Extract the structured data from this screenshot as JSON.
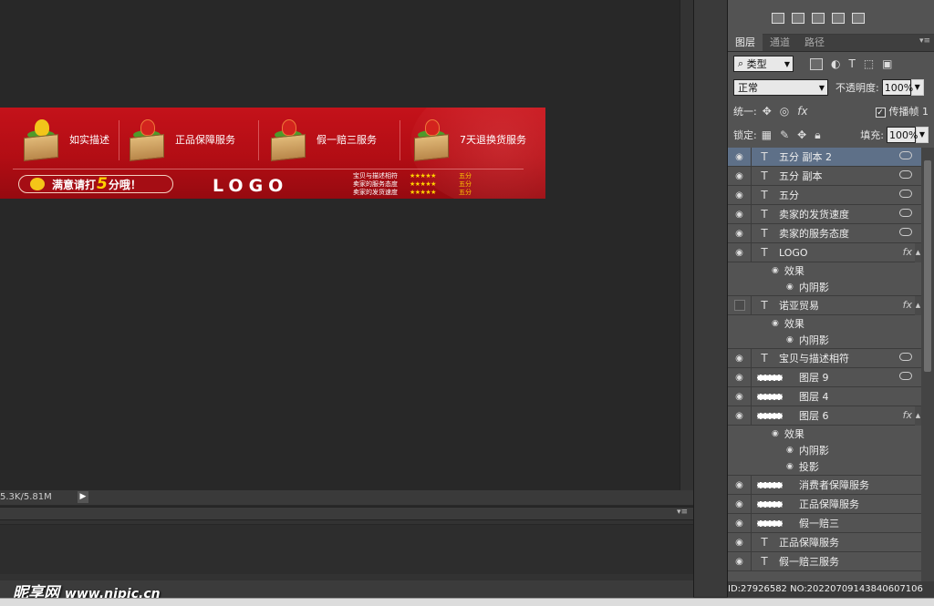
{
  "status": {
    "doc_size": "5.3K/5.81M"
  },
  "watermark": {
    "site": "昵享网",
    "url": "www.nipic.cn"
  },
  "id_line": "ID:27926582 NO:20220709143840607106",
  "banner": {
    "services": [
      {
        "label": "如实描述",
        "flower": "yellow"
      },
      {
        "label": "正品保障服务",
        "flower": "red"
      },
      {
        "label": "假一赔三服务",
        "flower": "red"
      },
      {
        "label": "7天退换货服务",
        "flower": "red"
      }
    ],
    "pill": {
      "before": "满意请打",
      "num": "5",
      "after": "分哦！"
    },
    "logo": "LOGO",
    "ratings": [
      {
        "label": "宝贝与描述相符",
        "stars": "★★★★★",
        "score": "五分"
      },
      {
        "label": "卖家的服务态度",
        "stars": "★★★★★",
        "score": "五分"
      },
      {
        "label": "卖家的发货速度",
        "stars": "★★★★★",
        "score": "五分"
      }
    ]
  },
  "panel": {
    "tabs": [
      "图层",
      "通道",
      "路径"
    ],
    "filter": "类型",
    "blend_mode": "正常",
    "opacity_label": "不透明度:",
    "opacity": "100%",
    "unify_label": "统一:",
    "propagate_label": "传播帧 1",
    "lock_label": "锁定:",
    "fill_label": "填充:",
    "fill": "100%"
  },
  "layers": [
    {
      "kind": "T",
      "name": "五分 副本 2",
      "visible": true,
      "selected": true,
      "badge": "link"
    },
    {
      "kind": "T",
      "name": "五分 副本",
      "visible": true,
      "badge": "link"
    },
    {
      "kind": "T",
      "name": "五分",
      "visible": true,
      "badge": "link"
    },
    {
      "kind": "T",
      "name": "卖家的发货速度",
      "visible": true,
      "badge": "link"
    },
    {
      "kind": "T",
      "name": "卖家的服务态度",
      "visible": true,
      "badge": "link"
    },
    {
      "kind": "T",
      "name": "LOGO",
      "visible": true,
      "badge": "fx",
      "effects_label": "效果",
      "effects": [
        "内阴影"
      ]
    },
    {
      "kind": "T",
      "name": "诺亚贸易",
      "visible": false,
      "badge": "fx",
      "effects_label": "效果",
      "effects": [
        "内阴影"
      ]
    },
    {
      "kind": "T",
      "name": "宝贝与描述相符",
      "visible": true,
      "badge": "link"
    },
    {
      "kind": "img",
      "name": "图层 9",
      "visible": true,
      "badge": "link"
    },
    {
      "kind": "img",
      "name": "图层 4",
      "visible": true
    },
    {
      "kind": "img",
      "name": "图层 6",
      "visible": true,
      "badge": "fx",
      "effects_label": "效果",
      "effects": [
        "内阴影",
        "投影"
      ]
    },
    {
      "kind": "img",
      "name": "消费者保障服务",
      "visible": true
    },
    {
      "kind": "img",
      "name": "正品保障服务",
      "visible": true
    },
    {
      "kind": "img",
      "name": "假一赔三",
      "visible": true
    },
    {
      "kind": "T",
      "name": "正品保障服务",
      "visible": true
    },
    {
      "kind": "T",
      "name": "假一赔三服务",
      "visible": true
    }
  ]
}
